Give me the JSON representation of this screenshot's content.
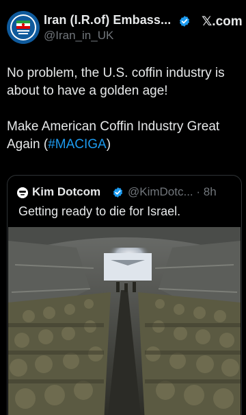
{
  "post": {
    "author": {
      "display_name": "Iran (I.R.of) Embass...",
      "handle": "@Iran_in_UK",
      "verified": true,
      "avatar_icon": "embassy-emblem-avatar"
    },
    "platform": {
      "logo_icon": "x-logo-icon",
      "label": "𝕏.com"
    },
    "text": {
      "paragraph1": "No problem, the U.S. coffin industry is about to have a golden age!",
      "paragraph2_prefix": "Make American Coffin Industry Great Again (",
      "hashtag": "#MACIGA",
      "paragraph2_suffix": ")"
    },
    "quote": {
      "author_name": "Kim Dotcom",
      "handle_time": "@KimDotc... · 8h",
      "verified": true,
      "text": "Getting ready to die for Israel.",
      "image_icon": "soldiers-in-aircraft-photo"
    }
  },
  "colors": {
    "background": "#000000",
    "text": "#e7e9ea",
    "muted": "#71767b",
    "accent": "#1d9bf0",
    "border": "#2f3336"
  }
}
